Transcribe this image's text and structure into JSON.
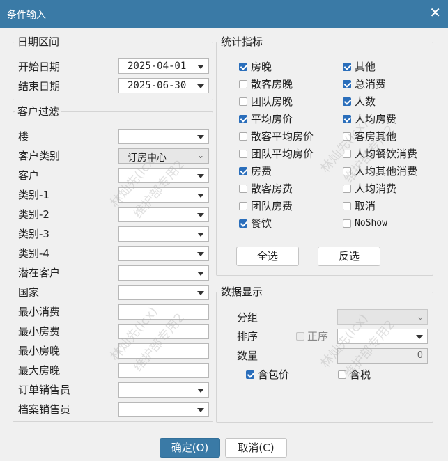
{
  "window": {
    "title": "条件输入",
    "close_glyph": "✕"
  },
  "date_range": {
    "title": "日期区间",
    "start_label": "开始日期",
    "start_value": "2025-04-01",
    "end_label": "结束日期",
    "end_value": "2025-06-30"
  },
  "customer_filter": {
    "title": "客户过滤",
    "fields": [
      {
        "label": "楼",
        "value": ""
      },
      {
        "label": "客户类别",
        "value": "订房中心"
      },
      {
        "label": "客户",
        "value": ""
      },
      {
        "label": "类别-1",
        "value": ""
      },
      {
        "label": "类别-2",
        "value": ""
      },
      {
        "label": "类别-3",
        "value": ""
      },
      {
        "label": "类别-4",
        "value": ""
      },
      {
        "label": "潜在客户",
        "value": ""
      },
      {
        "label": "国家",
        "value": ""
      },
      {
        "label": "最小消费",
        "value": ""
      },
      {
        "label": "最小房费",
        "value": ""
      },
      {
        "label": "最小房晚",
        "value": ""
      },
      {
        "label": "最大房晚",
        "value": ""
      },
      {
        "label": "订单销售员",
        "value": ""
      },
      {
        "label": "档案销售员",
        "value": ""
      }
    ]
  },
  "stats": {
    "title": "统计指标",
    "left": [
      {
        "label": "房晚",
        "checked": true
      },
      {
        "label": "散客房晚",
        "checked": false
      },
      {
        "label": "团队房晚",
        "checked": false
      },
      {
        "label": "平均房价",
        "checked": true
      },
      {
        "label": "散客平均房价",
        "checked": false
      },
      {
        "label": "团队平均房价",
        "checked": false
      },
      {
        "label": "房费",
        "checked": true
      },
      {
        "label": "散客房费",
        "checked": false
      },
      {
        "label": "团队房费",
        "checked": false
      },
      {
        "label": "餐饮",
        "checked": true
      }
    ],
    "right": [
      {
        "label": "其他",
        "checked": true
      },
      {
        "label": "总消费",
        "checked": true
      },
      {
        "label": "人数",
        "checked": true
      },
      {
        "label": "人均房费",
        "checked": true
      },
      {
        "label": "客房其他",
        "checked": false
      },
      {
        "label": "人均餐饮消费",
        "checked": false
      },
      {
        "label": "人均其他消费",
        "checked": false
      },
      {
        "label": "人均消费",
        "checked": false
      },
      {
        "label": "取消",
        "checked": false
      },
      {
        "label": "NoShow",
        "checked": false
      }
    ],
    "select_all": "全选",
    "invert": "反选"
  },
  "display": {
    "title": "数据显示",
    "group_label": "分组",
    "sort_label": "排序",
    "asc_label": "正序",
    "count_label": "数量",
    "count_value": "0",
    "package_label": "含包价",
    "package_checked": true,
    "tax_label": "含税",
    "tax_checked": false
  },
  "footer": {
    "ok": "确定(O)",
    "cancel": "取消(C)"
  },
  "watermark": [
    "林灿先(lcx)",
    "维护部专用2"
  ],
  "colors": {
    "title_bar": "#3a7aa6",
    "check_accent": "#2a6ebb"
  }
}
